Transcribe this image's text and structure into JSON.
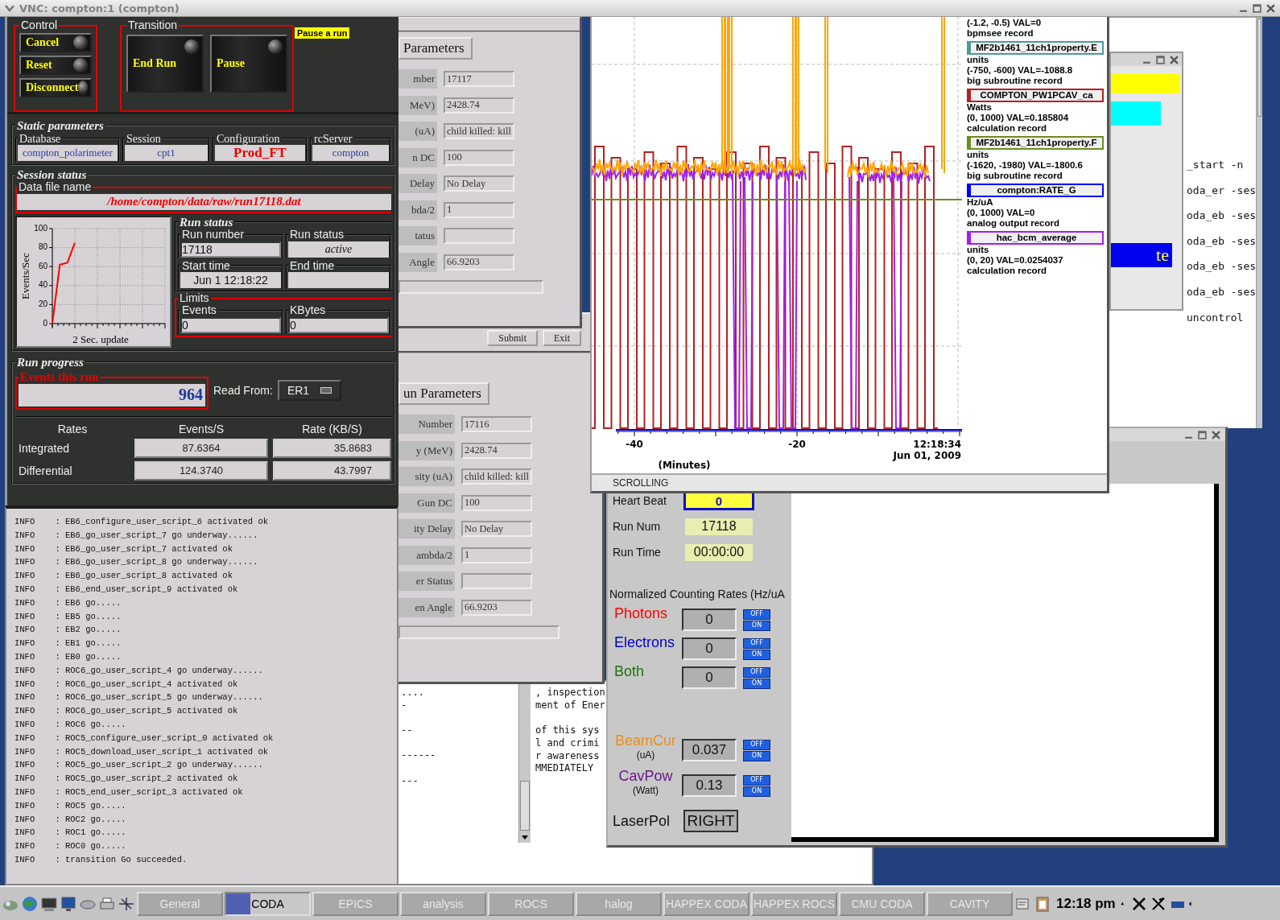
{
  "vnc_title": "VNC: compton:1 (compton)",
  "runcontrol": {
    "control": {
      "title": "Control",
      "buttons": [
        "Cancel",
        "Reset",
        "Disconnect"
      ]
    },
    "transition": {
      "title": "Transition",
      "buttons": [
        "End Run",
        "Pause"
      ],
      "tooltip": "Pause a run"
    },
    "static_parameters": {
      "title": "Static parameters",
      "fields": [
        {
          "label": "Database",
          "value": "compton_polarimeter",
          "kind": "plain"
        },
        {
          "label": "Session",
          "value": "cpt1",
          "kind": "plain"
        },
        {
          "label": "Configuration",
          "value": "Prod_FT",
          "kind": "highlight"
        },
        {
          "label": "rcServer",
          "value": "compton",
          "kind": "plain"
        }
      ]
    },
    "session_status": {
      "title": "Session status",
      "data_file": {
        "label": "Data file name",
        "value": "/home/compton/data/raw/run17118.dat"
      },
      "rate_chart": {
        "chart_data": {
          "type": "line",
          "xlabel": "2 Sec. update",
          "categories": [
            null,
            null,
            null,
            null,
            null,
            null,
            null,
            null,
            null,
            null,
            null,
            null,
            null,
            null,
            null,
            null
          ],
          "series": [
            {
              "name": "Events/Sec",
              "color": "#ff0000",
              "values": [
                0,
                62,
                64,
                85,
                null,
                null,
                null,
                null,
                null,
                null,
                null,
                null,
                null,
                null,
                null,
                null
              ]
            }
          ],
          "ylim": [
            0,
            100
          ],
          "yticks": [
            0,
            20,
            40,
            60,
            80,
            100
          ],
          "grid": true
        }
      },
      "run_status": {
        "title": "Run status",
        "fields": [
          {
            "label": "Run number",
            "value": "17118",
            "kind": "input"
          },
          {
            "label": "Run status",
            "value": "active",
            "kind": "status"
          },
          {
            "label": "Start time",
            "value": "Jun 1 12:18:22",
            "kind": "display"
          },
          {
            "label": "End time",
            "kind": "display"
          }
        ]
      },
      "limits": {
        "title": "Limits",
        "fields": [
          {
            "label": "Events",
            "value": "0"
          },
          {
            "label": "KBytes",
            "value": "0"
          }
        ]
      }
    },
    "run_progress": {
      "title": "Run progress",
      "events_label": "Events this run",
      "events_value": "964",
      "read_from_label": "Read From:",
      "read_from_value": "ER1",
      "rates": {
        "columns": [
          "Rates",
          "Events/S",
          "Rate (KB/S)"
        ],
        "rows": [
          {
            "label": "Integrated",
            "events": "87.6364",
            "rate": "35.8683"
          },
          {
            "label": "Differential",
            "events": "124.3740",
            "rate": "43.7997"
          }
        ]
      }
    }
  },
  "log": [
    "INFO    : EB6_configure_user_script_6 activated ok",
    "INFO    : EB6_go_user_script_7 go underway......",
    "INFO    : EB6_go_user_script_7 activated ok",
    "INFO    : EB6_go_user_script_8 go underway......",
    "INFO    : EB6_go_user_script_8 activated ok",
    "INFO    : EB6_end_user_script_9 activated ok",
    "INFO    : EB6 go.....",
    "INFO    : EB5 go.....",
    "INFO    : EB2 go.....",
    "INFO    : EB1 go.....",
    "INFO    : EB0 go.....",
    "INFO    : ROC6_go_user_script_4 go underway......",
    "INFO    : ROC6_go_user_script_4 activated ok",
    "INFO    : ROC6_go_user_script_5 go underway......",
    "INFO    : ROC6_go_user_script_5 activated ok",
    "INFO    : ROC6 go.....",
    "INFO    : ROC5_configure_user_script_0 activated ok",
    "INFO    : ROC5_download_user_script_1 activated ok",
    "INFO    : ROC5_go_user_script_2 go underway......",
    "INFO    : ROC5_go_user_script_2 activated ok",
    "INFO    : ROC5_end_user_script_3 activated ok",
    "INFO    : ROC5 go.....",
    "INFO    : ROC2 go.....",
    "INFO    : ROC1 go.....",
    "INFO    : ROC0 go.....",
    "INFO    : transition Go succeeded."
  ],
  "parameters_window_1": {
    "title": "Parameters",
    "rows": [
      {
        "label": "mber",
        "value": "17117"
      },
      {
        "label": "MeV)",
        "value": "2428.74"
      },
      {
        "label": "(uA)",
        "value": "child killed: kill"
      },
      {
        "label": "n DC",
        "value": "100"
      },
      {
        "label": "Delay",
        "value": "No Delay"
      },
      {
        "label": "bda/2",
        "value": "1"
      },
      {
        "label": "tatus"
      },
      {
        "label": "Angle",
        "value": "66.9203"
      }
    ]
  },
  "parameters_window_2": {
    "buttons": [
      "Submit",
      "Exit"
    ],
    "title": "un Parameters",
    "rows": [
      {
        "label": "Number",
        "value": "17116"
      },
      {
        "label": "y (MeV)",
        "value": "2428.74"
      },
      {
        "label": "sity (uA)",
        "value": "child killed: kill"
      },
      {
        "label": "Gun DC",
        "value": "100"
      },
      {
        "label": "ity Delay",
        "value": "No Delay"
      },
      {
        "label": "ambda/2",
        "value": "1"
      },
      {
        "label": "er Status"
      },
      {
        "label": "en Angle",
        "value": "66.9203"
      }
    ]
  },
  "terminal_bottom": {
    "left_blocks": [
      [
        "....",
        "-"
      ],
      [
        "--"
      ],
      [
        "------"
      ],
      [
        "---"
      ]
    ],
    "right_blocks": [
      [
        ", inspection",
        "ment of Ener"
      ],
      [
        "of this sys",
        "l and crimi",
        "r awareness",
        "MMEDIATELY"
      ]
    ]
  },
  "strip_chart": {
    "xticks": [
      "-40",
      "-20"
    ],
    "time": "12:18:34",
    "date": "Jun 01, 2009",
    "xlabel": "(Minutes)",
    "status": "SCROLLING",
    "legend": {
      "partial": {
        "range": "(-1.2, -0.5) VAL=0",
        "type": "bpmsee record"
      },
      "entries": [
        {
          "name": "MF2b1461_11ch1property.E",
          "color": "#4f9a9a",
          "units": "units",
          "range": "(-750, -600) VAL=-1088.8",
          "type": "big subroutine record"
        },
        {
          "name": "COMPTON_PW1PCAV_ca",
          "color": "#b22222",
          "units": "Watts",
          "range": "(0, 1000) VAL=0.185804",
          "type": "calculation record"
        },
        {
          "name": "MF2b1461_11ch1property.F",
          "color": "#6b8e23",
          "units": "units",
          "range": "(-1620, -1980) VAL=-1800.6",
          "type": "big subroutine record"
        },
        {
          "name": "compton:RATE_G",
          "color": "#0000ff",
          "units": "Hz/uA",
          "range": "(0, 1000) VAL=0",
          "type": "analog output record"
        },
        {
          "name": "hac_bcm_average",
          "color": "#a020f0",
          "units": "units",
          "range": "(0, 20) VAL=0.0254037",
          "type": "calculation record"
        }
      ]
    }
  },
  "terminal_right": {
    "lines": [
      "_start -n",
      "oda_er -ses",
      "oda_eb -ses",
      "oda_eb -ses",
      "oda_eb -ses",
      "oda_eb -ses",
      "uncontrol"
    ],
    "banner": "te"
  },
  "monitor": {
    "heartbeat": {
      "label": "Heart Beat",
      "value": "0"
    },
    "run_num": {
      "label": "Run Num",
      "value": "17118"
    },
    "run_time": {
      "label": "Run Time",
      "value": "00:00:00"
    },
    "rates_title": "Normalized Counting Rates (Hz/uA",
    "channels": [
      {
        "name": "Photons",
        "color": "#ff0000",
        "value": "0",
        "toggle": [
          "OFF",
          "ON"
        ]
      },
      {
        "name": "Electrons",
        "color": "#0000cc",
        "value": "0",
        "toggle": [
          "OFF",
          "ON"
        ]
      },
      {
        "name": "Both",
        "color": "#207010",
        "value": "0",
        "toggle": [
          "OFF",
          "ON"
        ]
      },
      {
        "name": "BeamCur",
        "unit": "(uA)",
        "color": "#e89020",
        "value": "0.037",
        "toggle": [
          "OFF",
          "ON"
        ]
      },
      {
        "name": "CavPow",
        "unit": "(Watt)",
        "color": "#6a1a8a",
        "value": "0.13",
        "toggle": [
          "OFF",
          "ON"
        ]
      }
    ],
    "laser_pol": {
      "label": "LaserPol",
      "value": "RIGHT"
    }
  },
  "taskbar": {
    "tasks": [
      {
        "label": "General",
        "selected": false
      },
      {
        "label": "CODA",
        "selected": true
      },
      {
        "label": "EPICS",
        "selected": false
      },
      {
        "label": "analysis",
        "selected": false
      },
      {
        "label": "ROCS",
        "selected": false
      },
      {
        "label": "halog",
        "selected": false
      },
      {
        "label": "HAPPEX CODA",
        "selected": false
      },
      {
        "label": "HAPPEX ROCS",
        "selected": false
      },
      {
        "label": "CMU CODA",
        "selected": false
      },
      {
        "label": "CAVITY",
        "selected": false
      }
    ],
    "clock": "12:18 pm"
  }
}
